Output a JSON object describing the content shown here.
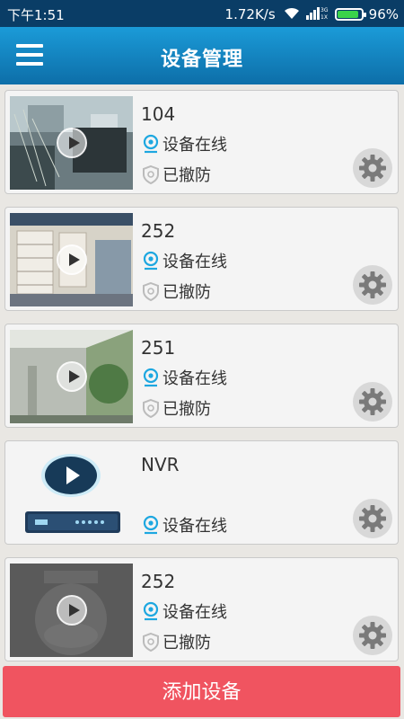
{
  "status_bar": {
    "time": "下午1:51",
    "speed": "1.72K/s",
    "network": "3G 1X",
    "battery": "96%",
    "battery_level": 0.96
  },
  "header": {
    "title": "设备管理",
    "menu_icon": "hamburger-menu-icon"
  },
  "devices": [
    {
      "name": "104",
      "online_label": "设备在线",
      "arm_label": "已撤防",
      "thumb": "camera-office"
    },
    {
      "name": "252",
      "online_label": "设备在线",
      "arm_label": "已撤防",
      "thumb": "camera-showroom"
    },
    {
      "name": "251",
      "online_label": "设备在线",
      "arm_label": "已撤防",
      "thumb": "camera-outdoor"
    },
    {
      "name": "NVR",
      "online_label": "设备在线",
      "thumb": "nvr-device"
    },
    {
      "name": "252",
      "online_label": "设备在线",
      "arm_label": "已撤防",
      "thumb": "ptz-camera-placeholder"
    }
  ],
  "footer": {
    "add_device_label": "添加设备"
  },
  "colors": {
    "header": "#1b9bd8",
    "accent": "#f05460",
    "online_icon": "#1da7e0"
  }
}
